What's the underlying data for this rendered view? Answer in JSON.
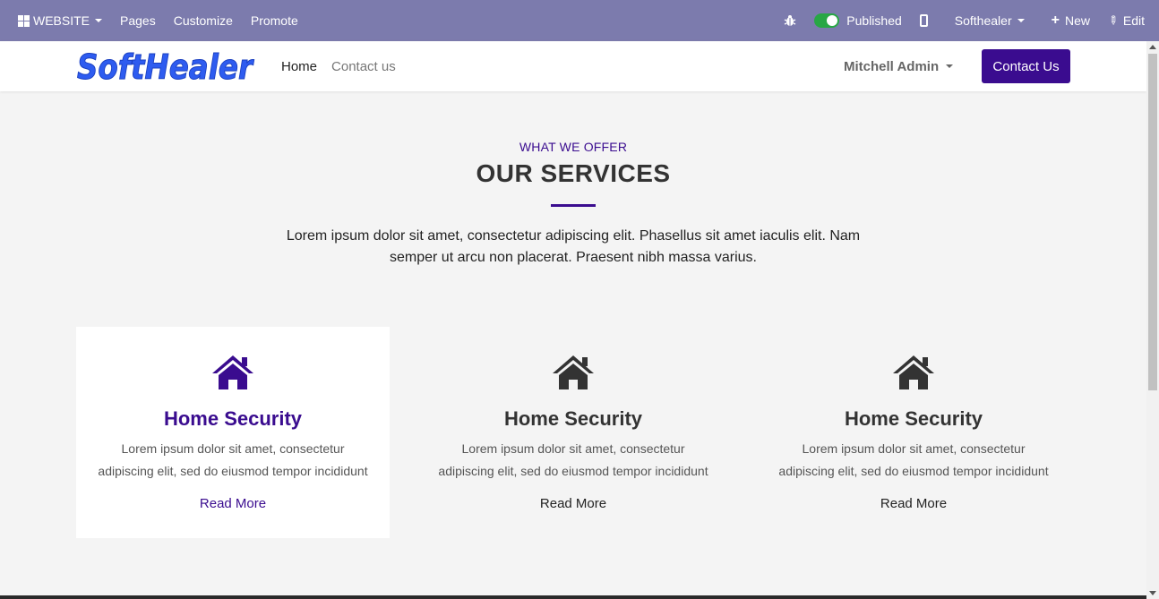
{
  "editor_bar": {
    "website_menu": "WEBSITE",
    "pages": "Pages",
    "customize": "Customize",
    "promote": "Promote",
    "published": "Published",
    "company": "Softhealer",
    "new": "New",
    "edit": "Edit"
  },
  "header": {
    "logo_text": "SoftHealer",
    "nav": {
      "home": "Home",
      "contact": "Contact us"
    },
    "user": "Mitchell Admin",
    "cta": "Contact Us"
  },
  "services": {
    "eyebrow": "WHAT WE OFFER",
    "title": "OUR SERVICES",
    "intro": "Lorem ipsum dolor sit amet, consectetur adipiscing elit. Phasellus sit amet iaculis elit. Nam semper ut arcu non placerat. Praesent nibh massa varius.",
    "cards": [
      {
        "title": "Home Security",
        "text": "Lorem ipsum dolor sit amet, consectetur adipiscing elit, sed do eiusmod tempor incididunt",
        "link": "Read More"
      },
      {
        "title": "Home Security",
        "text": "Lorem ipsum dolor sit amet, consectetur adipiscing elit, sed do eiusmod tempor incididunt",
        "link": "Read More"
      },
      {
        "title": "Home Security",
        "text": "Lorem ipsum dolor sit amet, consectetur adipiscing elit, sed do eiusmod tempor incididunt",
        "link": "Read More"
      }
    ]
  },
  "colors": {
    "editor_bar": "#7c7bad",
    "brand_purple": "#3a0c8f",
    "logo_blue": "#2e5cf0",
    "toggle_green": "#28a745"
  }
}
